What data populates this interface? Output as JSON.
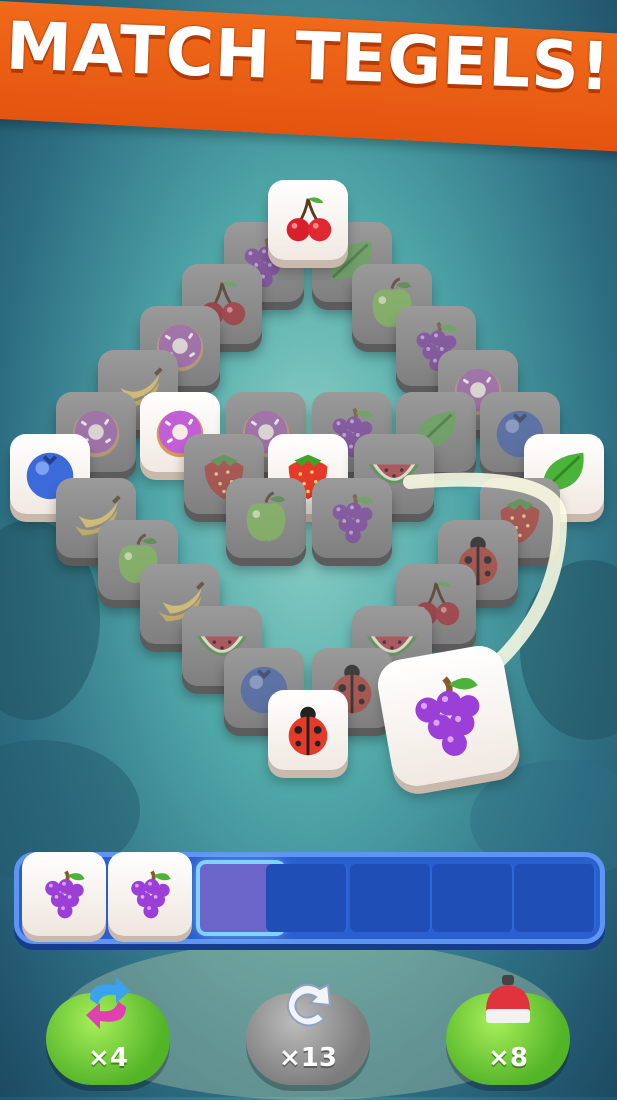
{
  "banner": {
    "title": "MATCH TEGELS!"
  },
  "board": {
    "tiles": [
      {
        "fruit": "grape",
        "dim": true
      },
      {
        "fruit": "leaf",
        "dim": true
      },
      {
        "fruit": "cherry",
        "dim": false
      },
      {
        "fruit": "cherry",
        "dim": true
      },
      {
        "fruit": "apple",
        "dim": true
      },
      {
        "fruit": "donut",
        "dim": true
      },
      {
        "fruit": "grape",
        "dim": true
      },
      {
        "fruit": "banana",
        "dim": true
      },
      {
        "fruit": "donut",
        "dim": true
      },
      {
        "fruit": "donut",
        "dim": true
      },
      {
        "fruit": "donut",
        "dim": false
      },
      {
        "fruit": "donut",
        "dim": true
      },
      {
        "fruit": "grape",
        "dim": true
      },
      {
        "fruit": "leaf",
        "dim": true
      },
      {
        "fruit": "blueberry",
        "dim": true
      },
      {
        "fruit": "blueberry",
        "dim": false
      },
      {
        "fruit": "strawberry",
        "dim": true
      },
      {
        "fruit": "strawberry",
        "dim": false
      },
      {
        "fruit": "watermelon",
        "dim": true
      },
      {
        "fruit": "leaf",
        "dim": false
      },
      {
        "fruit": "banana",
        "dim": true
      },
      {
        "fruit": "apple",
        "dim": true
      },
      {
        "fruit": "grape",
        "dim": true
      },
      {
        "fruit": "strawberry",
        "dim": true
      },
      {
        "fruit": "apple",
        "dim": true
      },
      {
        "fruit": "ladybug",
        "dim": true
      },
      {
        "fruit": "banana",
        "dim": true
      },
      {
        "fruit": "cherry",
        "dim": true
      },
      {
        "fruit": "watermelon",
        "dim": true
      },
      {
        "fruit": "watermelon",
        "dim": true
      },
      {
        "fruit": "blueberry",
        "dim": true
      },
      {
        "fruit": "ladybug",
        "dim": true
      },
      {
        "fruit": "ladybug",
        "dim": false
      }
    ],
    "flying_tile": {
      "fruit": "grape"
    }
  },
  "tray": {
    "slot_count": 7,
    "filled": [
      "grape",
      "grape"
    ],
    "active_slot": 2
  },
  "powerups": [
    {
      "name": "shuffle",
      "icon": "shuffle-icon",
      "count": "×4",
      "color": "#52b427"
    },
    {
      "name": "undo",
      "icon": "undo-icon",
      "count": "×13",
      "color": "#7c7c7c"
    },
    {
      "name": "magnet",
      "icon": "magnet-icon",
      "count": "×8",
      "color": "#52b427"
    }
  ]
}
